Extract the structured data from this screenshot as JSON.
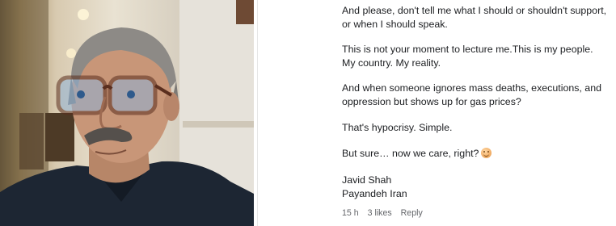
{
  "video": {
    "description_icon": "video-frame"
  },
  "comment": {
    "paragraphs": [
      "And please, don't tell me what I should or shouldn't support, or when I should speak.",
      "This is not your moment to lecture me.This is my people. My country. My reality.",
      "And when someone ignores mass deaths, executions, and oppression but shows up for gas prices?",
      "That's hypocrisy. Simple.",
      "But sure… now we care, right?"
    ],
    "emoji": "grinning-face-with-sweat-icon",
    "signature": {
      "name": "Javid Shah",
      "slogan": "Payandeh Iran"
    }
  },
  "meta": {
    "time": "15 h",
    "likes": "3 likes",
    "reply": "Reply"
  }
}
